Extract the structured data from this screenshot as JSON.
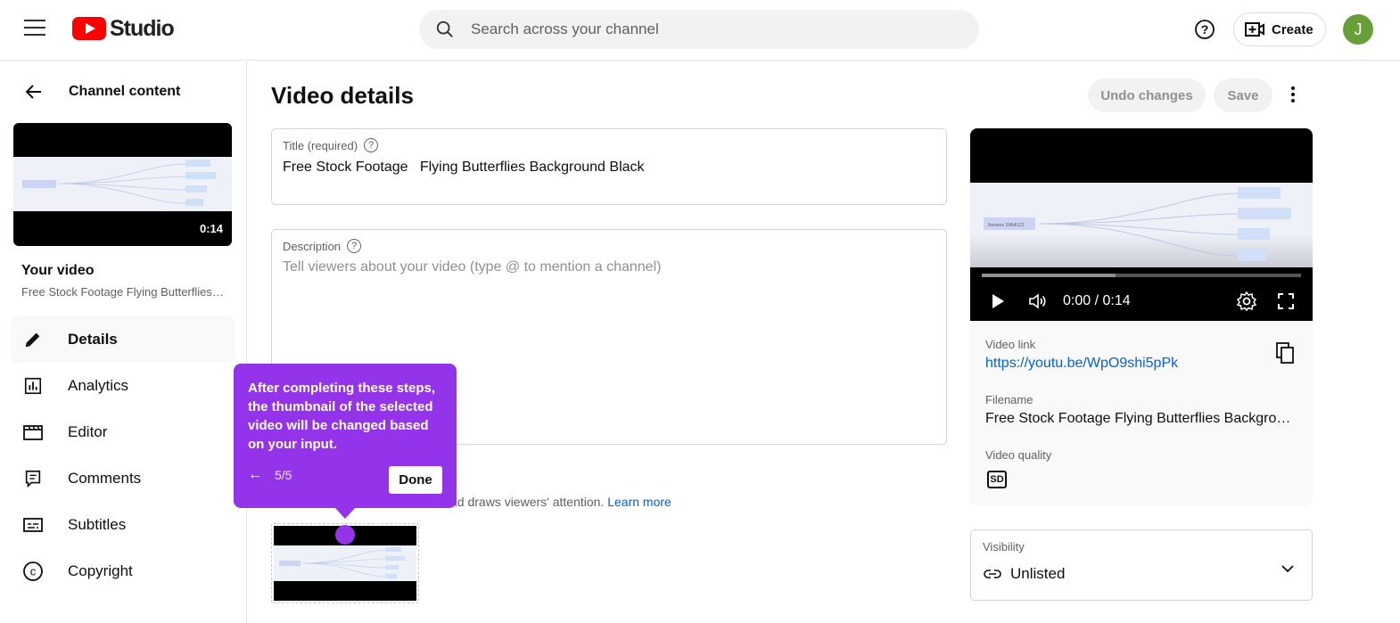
{
  "header": {
    "logo_text": "Studio",
    "search_placeholder": "Search across your channel",
    "create_label": "Create",
    "avatar_initial": "J"
  },
  "sidebar": {
    "back_title": "Channel content",
    "thumbnail_duration": "0:14",
    "your_video_label": "Your video",
    "video_name": "Free Stock Footage Flying Butterflies Background Black",
    "nav": [
      {
        "label": "Details",
        "icon": "pencil-icon",
        "active": true
      },
      {
        "label": "Analytics",
        "icon": "analytics-icon"
      },
      {
        "label": "Editor",
        "icon": "editor-icon"
      },
      {
        "label": "Comments",
        "icon": "comments-icon"
      },
      {
        "label": "Subtitles",
        "icon": "subtitles-icon"
      },
      {
        "label": "Copyright",
        "icon": "copyright-icon"
      }
    ]
  },
  "main": {
    "page_title": "Video details",
    "undo_label": "Undo changes",
    "save_label": "Save",
    "title_label": "Title (required)",
    "title_value": "Free Stock Footage   Flying Butterflies Background Black",
    "description_label": "Description",
    "description_placeholder": "Tell viewers about your video (type @ to mention a channel)",
    "thumbnail_help": "nd draws viewers' attention.",
    "learn_more": "Learn more"
  },
  "tooltip": {
    "text": "After completing these steps, the thumbnail of the selected video will be changed based on your input.",
    "step": "5/5",
    "done_label": "Done"
  },
  "player": {
    "time": "0:00 / 0:14",
    "buffered_fraction": 0.42
  },
  "info": {
    "video_link_label": "Video link",
    "video_link": "https://youtu.be/WpO9shi5pPk",
    "filename_label": "Filename",
    "filename": "Free Stock Footage Flying Butterflies Background Black",
    "quality_label": "Video quality",
    "quality_badge": "SD"
  },
  "visibility": {
    "label": "Visibility",
    "value": "Unlisted"
  },
  "colors": {
    "accent_purple": "#9333ea",
    "youtube_red": "#ff0000",
    "link_blue": "#065fd4",
    "avatar_green": "#689f38"
  }
}
